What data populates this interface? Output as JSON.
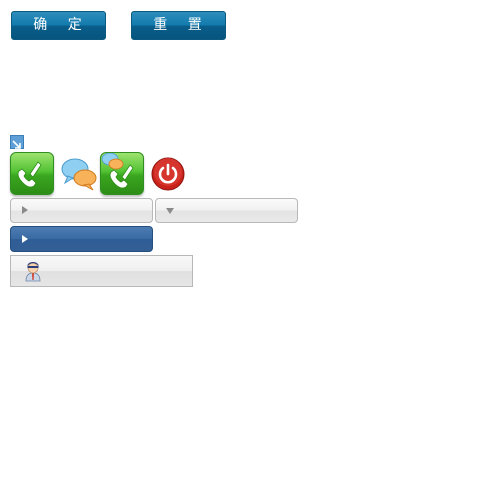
{
  "toolbar": {
    "confirm_label": "确 定",
    "reset_label": "重 置"
  },
  "icons": {
    "expand": "expand-arrow-icon",
    "phone_call": "phone-icon",
    "chat": "chat-bubbles-icon",
    "phone_chat": "phone-chat-icon",
    "power": "power-icon",
    "user": "user-avatar-icon"
  },
  "colors": {
    "primary_button": "#137bae",
    "phone_green": "#52c233",
    "power_red": "#c8221a",
    "active_bar": "#3a6aa3"
  }
}
